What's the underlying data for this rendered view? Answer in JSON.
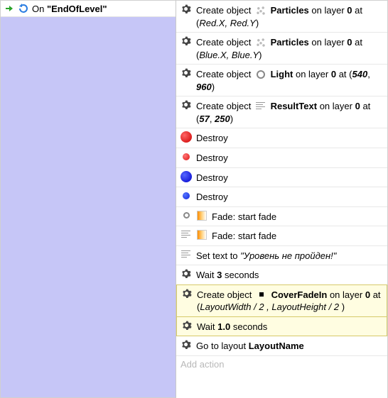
{
  "condition": {
    "label_prefix": "On",
    "function_name": "\"EndOfLevel\""
  },
  "actions": {
    "create_label": "Create object",
    "on_layer": "on layer",
    "at": "at",
    "destroy": "Destroy",
    "fade_start": "Fade: start fade",
    "wait": "Wait",
    "seconds": "seconds",
    "goto": "Go to layout",
    "settext": "Set text to",
    "layout_name": "LayoutName",
    "add_action": "Add action",
    "rows": [
      {
        "obj": "Particles",
        "layer": "0",
        "pos": "Red.X, Red.Y"
      },
      {
        "obj": "Particles",
        "layer": "0",
        "pos": "Blue.X, Blue.Y"
      },
      {
        "obj": "Light",
        "layer": "0",
        "pos_nums": [
          "540",
          "960"
        ]
      },
      {
        "obj": "ResultText",
        "layer": "0",
        "pos_nums": [
          "57",
          "250"
        ]
      }
    ],
    "set_text_value": "\"Уровень не пройден!\"",
    "wait1": "3",
    "coverfadein": {
      "obj": "CoverFadeIn",
      "layer": "0",
      "pos": "LayoutWidth / 2 , LayoutHeight / 2 "
    },
    "wait2": "1.0"
  }
}
